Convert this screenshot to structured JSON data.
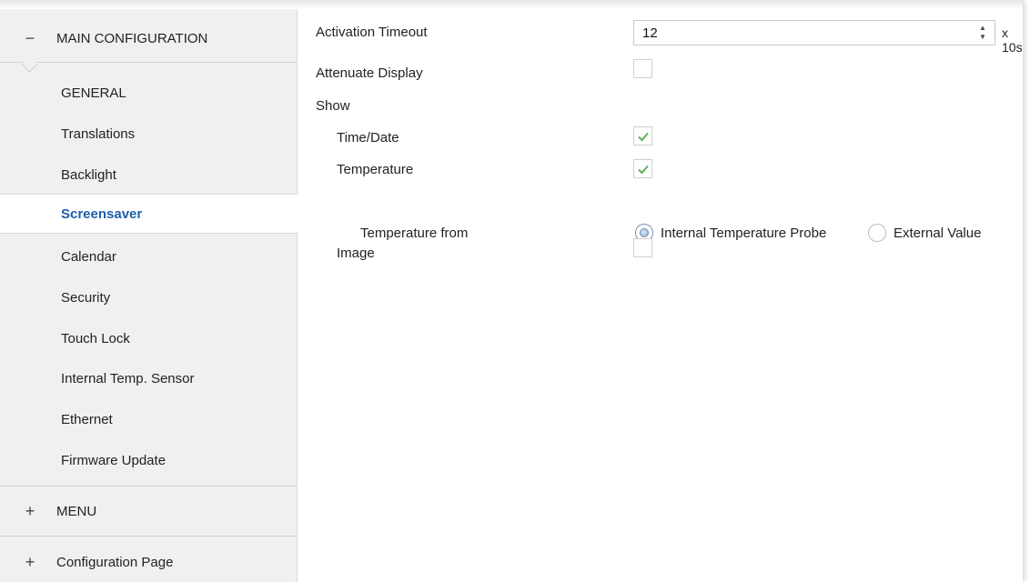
{
  "sidebar": {
    "main_section": {
      "sign": "−",
      "title": "MAIN CONFIGURATION"
    },
    "items": [
      {
        "label": "GENERAL"
      },
      {
        "label": "Translations"
      },
      {
        "label": "Backlight"
      },
      {
        "label": "Screensaver"
      },
      {
        "label": "Calendar"
      },
      {
        "label": "Security"
      },
      {
        "label": "Touch Lock"
      },
      {
        "label": "Internal Temp. Sensor"
      },
      {
        "label": "Ethernet"
      },
      {
        "label": "Firmware Update"
      }
    ],
    "active_item": "Screensaver",
    "menu_section": {
      "sign": "+",
      "title": "MENU"
    },
    "config_section": {
      "sign": "+",
      "title": "Configuration Page"
    }
  },
  "main": {
    "activation_timeout": {
      "label": "Activation Timeout",
      "value": "12",
      "unit": "x 10s"
    },
    "attenuate_display": {
      "label": "Attenuate Display",
      "checked": false
    },
    "show_label": "Show",
    "time_date": {
      "label": "Time/Date",
      "checked": true
    },
    "temperature": {
      "label": "Temperature",
      "checked": true
    },
    "temperature_from": {
      "label": "Temperature from",
      "options": [
        "Internal Temperature Probe",
        "External Value"
      ],
      "selected": "Internal Temperature Probe"
    },
    "image": {
      "label": "Image",
      "checked": false
    }
  },
  "colors": {
    "sidebar_bg": "#f0f0f0",
    "active_text": "#1f5fa8",
    "check_green": "#5fae5f"
  }
}
